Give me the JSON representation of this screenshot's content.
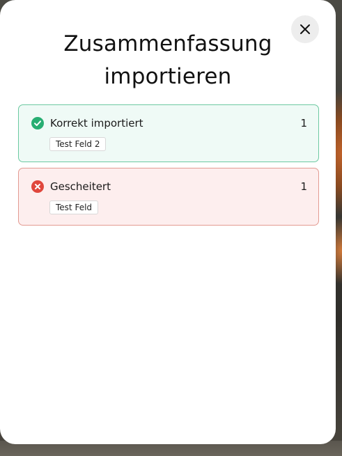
{
  "dialog": {
    "title": "Zusammenfassung importieren",
    "close_icon": "close-icon"
  },
  "results": [
    {
      "status": "success",
      "label": "Korrekt importiert",
      "count": "1",
      "icon": "check-circle-icon",
      "accent_color": "#27ae72",
      "tags": [
        "Test Feld 2"
      ]
    },
    {
      "status": "failure",
      "label": "Gescheitert",
      "count": "1",
      "icon": "error-circle-icon",
      "accent_color": "#e0473d",
      "tags": [
        "Test Feld"
      ]
    }
  ]
}
